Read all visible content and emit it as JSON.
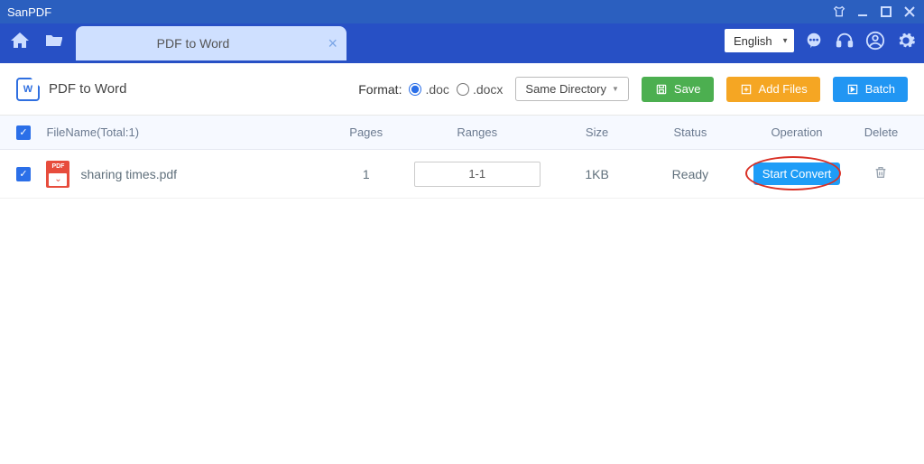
{
  "app": {
    "title": "SanPDF"
  },
  "tab": {
    "label": "PDF to Word"
  },
  "language": {
    "selected": "English"
  },
  "page": {
    "title": "PDF to Word",
    "icon_letter": "W",
    "format_label": "Format:",
    "format_options": {
      "doc": ".doc",
      "docx": ".docx"
    },
    "same_dir": "Same Directory",
    "save": "Save",
    "add_files": "Add Files",
    "batch": "Batch"
  },
  "table": {
    "header": {
      "filename": "FileName(Total:1)",
      "pages": "Pages",
      "ranges": "Ranges",
      "size": "Size",
      "status": "Status",
      "operation": "Operation",
      "delete": "Delete"
    },
    "rows": [
      {
        "filename": "sharing times.pdf",
        "pages": "1",
        "ranges": "1-1",
        "size": "1KB",
        "status": "Ready",
        "op": "Start Convert"
      }
    ]
  }
}
